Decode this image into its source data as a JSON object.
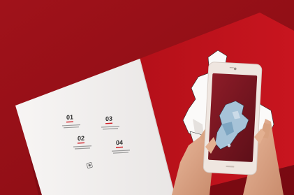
{
  "scene": {
    "description_colors": {
      "background": "#9b0f16",
      "book_red": "#c1121c",
      "paper": "#f4f2f1",
      "phone_body": "#efe6e0",
      "phone_screen": "#7d1520",
      "accent_underline": "#d21a22"
    }
  },
  "book": {
    "steps": [
      {
        "number": "01"
      },
      {
        "number": "02"
      },
      {
        "number": "03"
      },
      {
        "number": "04"
      }
    ]
  },
  "icons": {
    "book_icon": "qr-icon",
    "phone_icon": "smartphone-icon"
  }
}
